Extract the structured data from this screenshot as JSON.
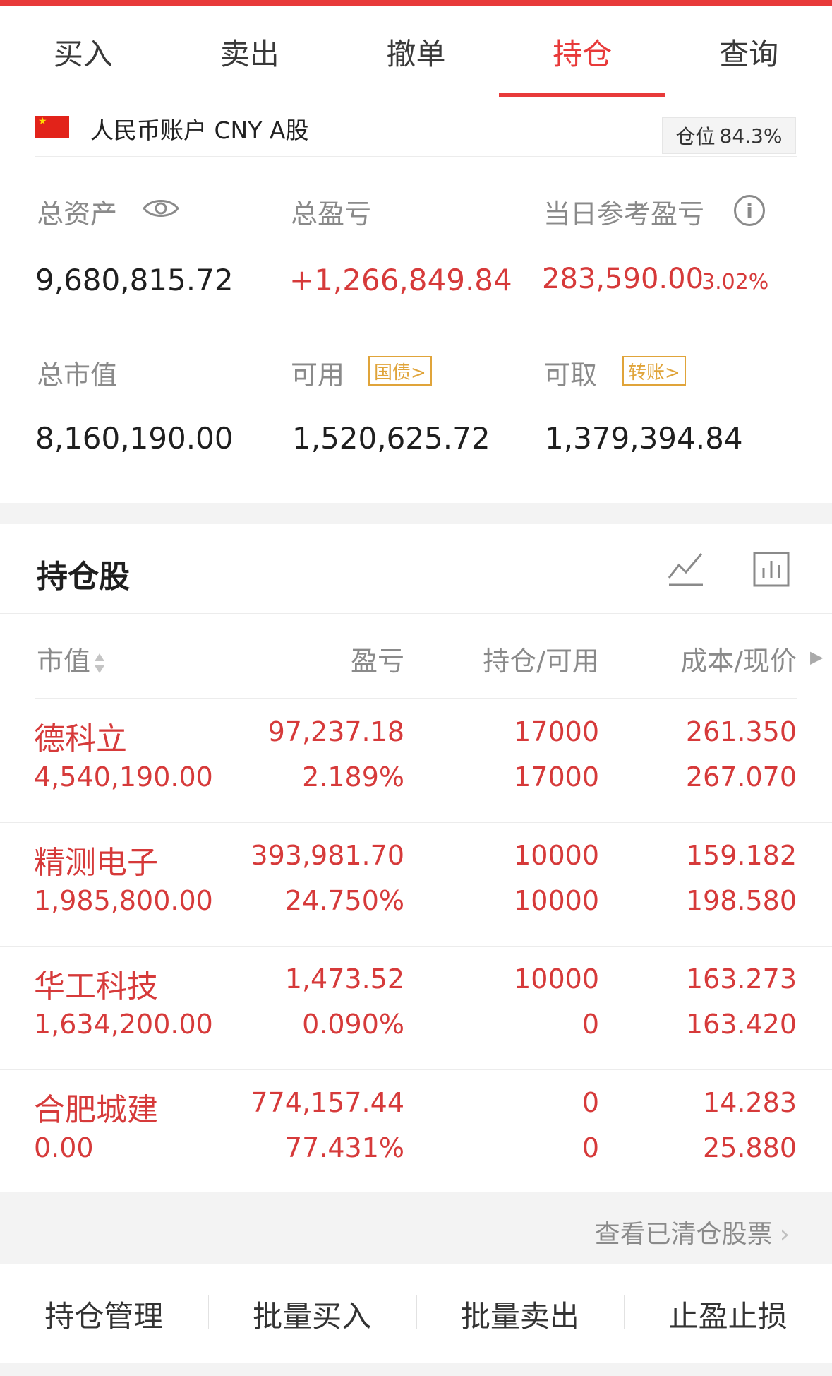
{
  "tabs": [
    {
      "label": "买入",
      "active": false
    },
    {
      "label": "卖出",
      "active": false
    },
    {
      "label": "撤单",
      "active": false
    },
    {
      "label": "持仓",
      "active": true
    },
    {
      "label": "查询",
      "active": false
    }
  ],
  "account": {
    "flag_icon": "china-flag-icon",
    "name": "人民币账户 CNY A股",
    "position_label": "仓位",
    "position_value": "84.3%"
  },
  "summary": {
    "total_assets_label": "总资产",
    "total_assets_value": "9,680,815.72",
    "total_pl_label": "总盈亏",
    "total_pl_value": "+1,266,849.84",
    "daily_pl_label": "当日参考盈亏",
    "daily_pl_value": "283,590.00",
    "daily_pl_pct": "3.02%",
    "market_value_label": "总市值",
    "market_value_value": "8,160,190.00",
    "available_label": "可用",
    "available_tag": "国债>",
    "available_value": "1,520,625.72",
    "withdrawable_label": "可取",
    "withdrawable_tag": "转账>",
    "withdrawable_value": "1,379,394.84"
  },
  "holdings": {
    "title": "持仓股",
    "columns": [
      "市值",
      "盈亏",
      "持仓/可用",
      "成本/现价"
    ],
    "rows": [
      {
        "name": "德科立",
        "market_value": "4,540,190.00",
        "pl": "97,237.18",
        "pl_pct": "2.189%",
        "position": "17000",
        "available": "17000",
        "cost": "261.350",
        "price": "267.070"
      },
      {
        "name": "精测电子",
        "market_value": "1,985,800.00",
        "pl": "393,981.70",
        "pl_pct": "24.750%",
        "position": "10000",
        "available": "10000",
        "cost": "159.182",
        "price": "198.580"
      },
      {
        "name": "华工科技",
        "market_value": "1,634,200.00",
        "pl": "1,473.52",
        "pl_pct": "0.090%",
        "position": "10000",
        "available": "0",
        "cost": "163.273",
        "price": "163.420"
      },
      {
        "name": "合肥城建",
        "market_value": "0.00",
        "pl": "774,157.44",
        "pl_pct": "77.431%",
        "position": "0",
        "available": "0",
        "cost": "14.283",
        "price": "25.880"
      }
    ]
  },
  "cleared_link": "查看已清仓股票",
  "actions": [
    "持仓管理",
    "批量买入",
    "批量卖出",
    "止盈止损"
  ],
  "colors": {
    "accent": "#e83a3a",
    "gain": "#d63a3a",
    "tag": "#e0a43a",
    "muted": "#8a8a8a"
  }
}
